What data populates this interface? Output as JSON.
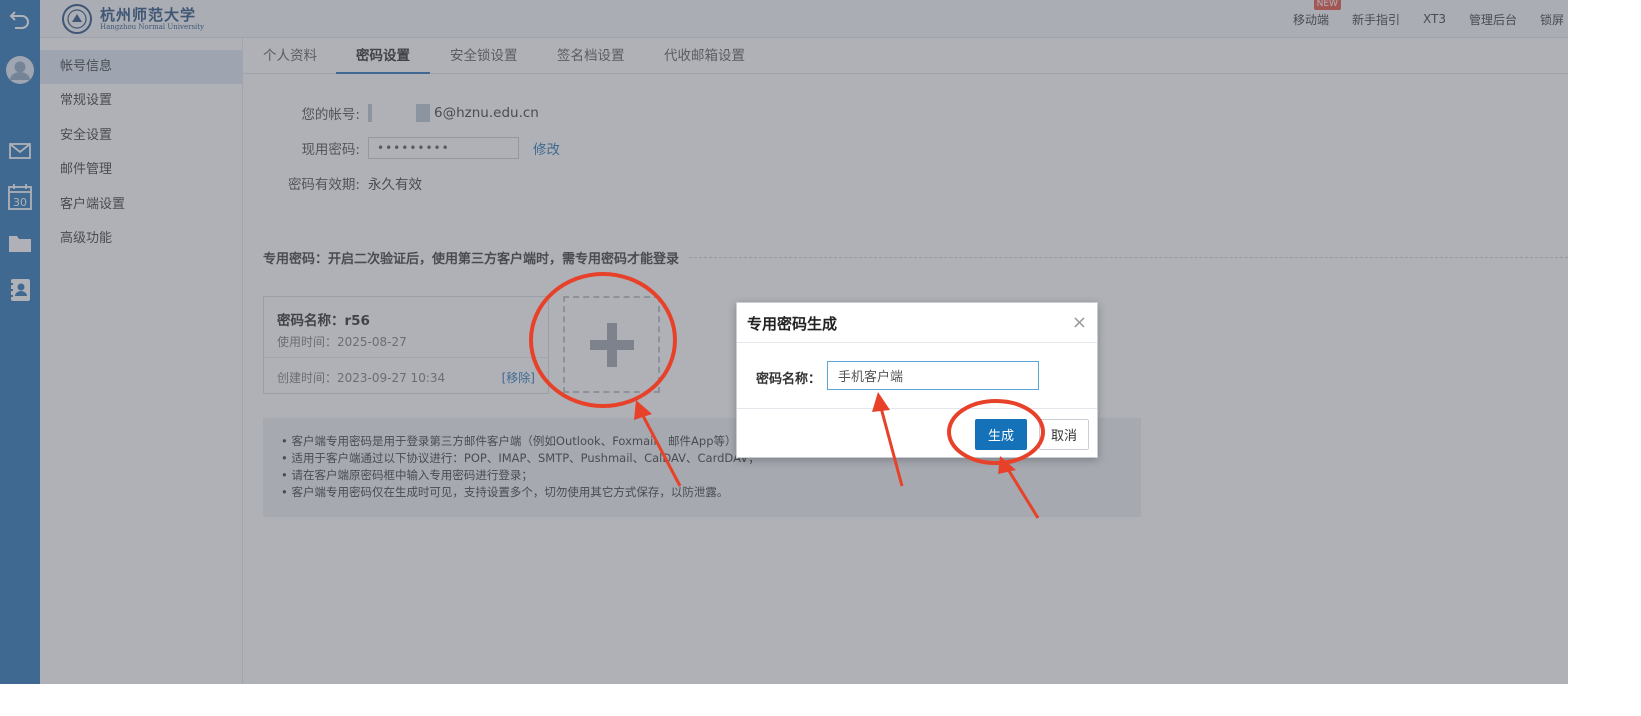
{
  "topbar": {
    "logo_cn": "杭州师范大学",
    "logo_en": "Hangzhou Normal University",
    "nav": [
      {
        "label": "移动端",
        "badge": "NEW"
      },
      {
        "label": "新手指引"
      },
      {
        "label": "XT3"
      },
      {
        "label": "管理后台"
      },
      {
        "label": "锁屏"
      }
    ]
  },
  "sidebar": {
    "items": [
      {
        "label": "帐号信息",
        "active": true
      },
      {
        "label": "常规设置"
      },
      {
        "label": "安全设置"
      },
      {
        "label": "邮件管理"
      },
      {
        "label": "客户端设置"
      },
      {
        "label": "高级功能"
      }
    ]
  },
  "tabs": [
    "个人资料",
    "密码设置",
    "安全锁设置",
    "签名档设置",
    "代收邮箱设置"
  ],
  "account": {
    "account_label": "您的帐号:",
    "account_value": "6@hznu.edu.cn",
    "password_label": "现用密码:",
    "password_value": "•••••••••",
    "modify_link": "修改",
    "validity_label": "密码有效期:",
    "validity_value": "永久有效"
  },
  "app_password": {
    "section_title": "专用密码：开启二次验证后，使用第三方客户端时，需专用密码才能登录",
    "card": {
      "name": "密码名称：r56",
      "used": "使用时间：2025-08-27",
      "created": "创建时间：2023-09-27 10:34",
      "remove": "[移除]"
    },
    "notes": [
      "• 客户端专用密码是用于登录第三方邮件客户端（例如Outlook、Foxmail、邮件App等）时",
      "• 适用于客户端通过以下协议进行：POP、IMAP、SMTP、Pushmail、CalDAV、CardDAV；",
      "• 请在客户端原密码框中输入专用密码进行登录；",
      "• 客户端专用密码仅在生成时可见，支持设置多个，切勿使用其它方式保存，以防泄露。"
    ]
  },
  "dialog": {
    "title": "专用密码生成",
    "close": "×",
    "name_label": "密码名称：",
    "name_value": "手机客户端",
    "generate": "生成",
    "cancel": "取消"
  },
  "colors": {
    "rail": "#1f6fb0",
    "primary_button": "#1572b8",
    "annotation": "#e8412a",
    "overlay": "rgba(95,100,112,0.5)"
  },
  "icons": [
    "back-arrow-icon",
    "avatar-icon",
    "mail-icon",
    "calendar-icon",
    "folder-icon",
    "contacts-icon",
    "plus-icon",
    "close-icon"
  ]
}
